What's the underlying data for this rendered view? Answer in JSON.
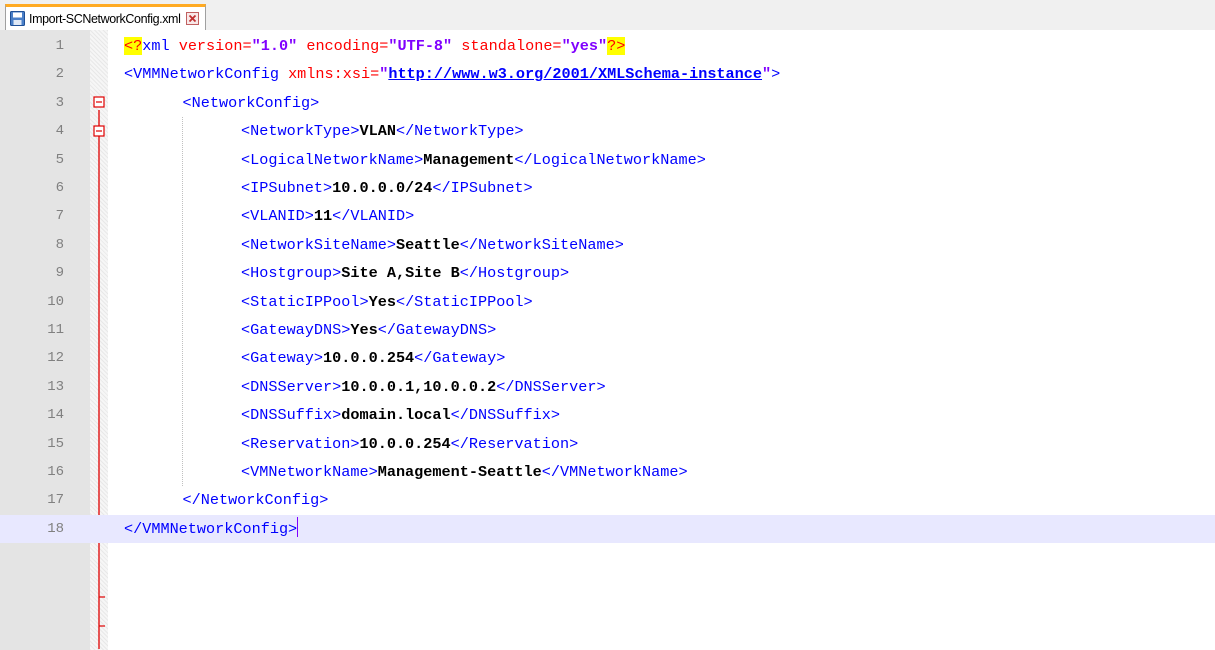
{
  "tab": {
    "label": "Import-SCNetworkConfig.xml",
    "icon": "save-disk-icon",
    "close_icon": "close-icon"
  },
  "editor": {
    "colors": {
      "tag": "#0000ff",
      "attribute": "#ff0000",
      "string": "#8000ff",
      "text": "#000000",
      "fold_line": "#e00000",
      "current_line": "#e8e8ff",
      "tab_accent": "#ffaa22"
    },
    "lines": [
      {
        "num": "1",
        "indent": 0,
        "segments": [
          {
            "t": "<?",
            "c": "pi"
          },
          {
            "t": "xml ",
            "c": "tag"
          },
          {
            "t": "version=",
            "c": "attr"
          },
          {
            "t": "\"1.0\"",
            "c": "str"
          },
          {
            "t": " ",
            "c": "tag"
          },
          {
            "t": "encoding=",
            "c": "attr"
          },
          {
            "t": "\"UTF-8\"",
            "c": "str"
          },
          {
            "t": " ",
            "c": "tag"
          },
          {
            "t": "standalone=",
            "c": "attr"
          },
          {
            "t": "\"yes\"",
            "c": "str"
          },
          {
            "t": "?>",
            "c": "pi"
          }
        ]
      },
      {
        "num": "2",
        "indent": 0,
        "segments": [
          {
            "t": "<VMMNetworkConfig ",
            "c": "tag"
          },
          {
            "t": "xmlns:xsi=",
            "c": "attr"
          },
          {
            "t": "\"",
            "c": "str"
          },
          {
            "t": "http://www.w3.org/2001/XMLSchema-instance",
            "c": "url"
          },
          {
            "t": "\"",
            "c": "str"
          },
          {
            "t": ">",
            "c": "tag"
          }
        ]
      },
      {
        "num": "3",
        "indent": 1,
        "segments": [
          {
            "t": "<NetworkConfig>",
            "c": "tag"
          }
        ]
      },
      {
        "num": "4",
        "indent": 2,
        "segments": [
          {
            "t": "<NetworkType>",
            "c": "tag"
          },
          {
            "t": "VLAN",
            "c": "txt"
          },
          {
            "t": "</NetworkType>",
            "c": "tag"
          }
        ]
      },
      {
        "num": "5",
        "indent": 2,
        "segments": [
          {
            "t": "<LogicalNetworkName>",
            "c": "tag"
          },
          {
            "t": "Management",
            "c": "txt"
          },
          {
            "t": "</LogicalNetworkName>",
            "c": "tag"
          }
        ]
      },
      {
        "num": "6",
        "indent": 2,
        "segments": [
          {
            "t": "<IPSubnet>",
            "c": "tag"
          },
          {
            "t": "10.0.0.0/24",
            "c": "txt"
          },
          {
            "t": "</IPSubnet>",
            "c": "tag"
          }
        ]
      },
      {
        "num": "7",
        "indent": 2,
        "segments": [
          {
            "t": "<VLANID>",
            "c": "tag"
          },
          {
            "t": "11",
            "c": "txt"
          },
          {
            "t": "</VLANID>",
            "c": "tag"
          }
        ]
      },
      {
        "num": "8",
        "indent": 2,
        "segments": [
          {
            "t": "<NetworkSiteName>",
            "c": "tag"
          },
          {
            "t": "Seattle",
            "c": "txt"
          },
          {
            "t": "</NetworkSiteName>",
            "c": "tag"
          }
        ]
      },
      {
        "num": "9",
        "indent": 2,
        "segments": [
          {
            "t": "<Hostgroup>",
            "c": "tag"
          },
          {
            "t": "Site A,Site B",
            "c": "txt"
          },
          {
            "t": "</Hostgroup>",
            "c": "tag"
          }
        ]
      },
      {
        "num": "10",
        "indent": 2,
        "segments": [
          {
            "t": "<StaticIPPool>",
            "c": "tag"
          },
          {
            "t": "Yes",
            "c": "txt"
          },
          {
            "t": "</StaticIPPool>",
            "c": "tag"
          }
        ]
      },
      {
        "num": "11",
        "indent": 2,
        "segments": [
          {
            "t": "<GatewayDNS>",
            "c": "tag"
          },
          {
            "t": "Yes",
            "c": "txt"
          },
          {
            "t": "</GatewayDNS>",
            "c": "tag"
          }
        ]
      },
      {
        "num": "12",
        "indent": 2,
        "segments": [
          {
            "t": "<Gateway>",
            "c": "tag"
          },
          {
            "t": "10.0.0.254",
            "c": "txt"
          },
          {
            "t": "</Gateway>",
            "c": "tag"
          }
        ]
      },
      {
        "num": "13",
        "indent": 2,
        "segments": [
          {
            "t": "<DNSServer>",
            "c": "tag"
          },
          {
            "t": "10.0.0.1,10.0.0.2",
            "c": "txt"
          },
          {
            "t": "</DNSServer>",
            "c": "tag"
          }
        ]
      },
      {
        "num": "14",
        "indent": 2,
        "segments": [
          {
            "t": "<DNSSuffix>",
            "c": "tag"
          },
          {
            "t": "domain.local",
            "c": "txt"
          },
          {
            "t": "</DNSSuffix>",
            "c": "tag"
          }
        ]
      },
      {
        "num": "15",
        "indent": 2,
        "segments": [
          {
            "t": "<Reservation>",
            "c": "tag"
          },
          {
            "t": "10.0.0.254",
            "c": "txt"
          },
          {
            "t": "</Reservation>",
            "c": "tag"
          }
        ]
      },
      {
        "num": "16",
        "indent": 2,
        "segments": [
          {
            "t": "<VMNetworkName>",
            "c": "tag"
          },
          {
            "t": "Management-Seattle",
            "c": "txt"
          },
          {
            "t": "</VMNetworkName>",
            "c": "tag"
          }
        ]
      },
      {
        "num": "17",
        "indent": 1,
        "segments": [
          {
            "t": "</NetworkConfig>",
            "c": "tag"
          }
        ]
      },
      {
        "num": "18",
        "indent": 0,
        "current": true,
        "segments": [
          {
            "t": "</VMMNetworkConfig>",
            "c": "tag"
          }
        ]
      }
    ]
  }
}
